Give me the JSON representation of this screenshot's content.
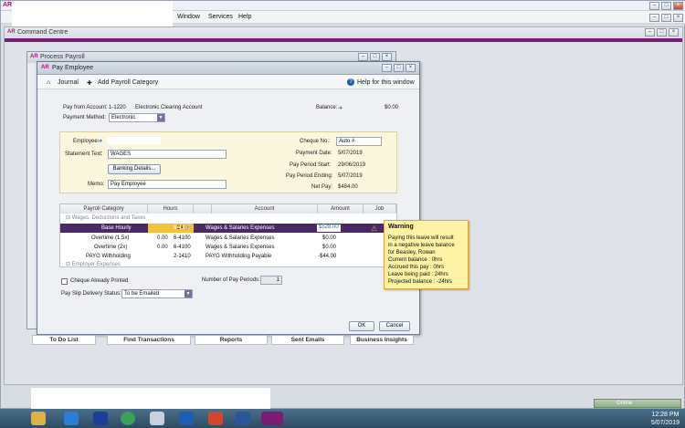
{
  "app": {
    "logo": "AR",
    "menu": [
      "Window",
      "Services",
      "Help"
    ],
    "command_centre_title": "Command Centre",
    "process_payroll_title": "Process Payroll"
  },
  "pay_employee": {
    "title": "Pay Employee",
    "toolbar": {
      "journal": "Journal",
      "add_payroll_category": "Add Payroll Category",
      "help": "Help for this window"
    },
    "pay_from_account_label": "Pay from Account:",
    "pay_from_account_code": "1-1220",
    "pay_from_account_name": "Electronic Clearing Account",
    "balance_label": "Balance:",
    "balance_value": "$0.00",
    "payment_method_label": "Payment Method:",
    "payment_method_value": "Electronic",
    "employee_label": "Employee:",
    "cheque_no_label": "Cheque No.:",
    "cheque_no_value": "Auto #",
    "statement_text_label": "Statement Text:",
    "statement_text_value": "WAGES",
    "payment_date_label": "Payment Date:",
    "payment_date_value": "5/07/2019",
    "banking_details_button": "Banking Details...",
    "pay_period_start_label": "Pay Period Start:",
    "pay_period_start_value": "29/06/2019",
    "pay_period_ending_label": "Pay Period Ending:",
    "pay_period_ending_value": "5/07/2019",
    "memo_label": "Memo:",
    "memo_value": "Pay Employee",
    "net_pay_label": "Net Pay:",
    "net_pay_value": "$484.00",
    "columns": [
      "Payroll Category",
      "Hours",
      "Account",
      "Amount",
      "Job"
    ],
    "group_1": "Wages, Deductions and Taxes",
    "rows": [
      {
        "category": "Base Hourly",
        "hours": "24.00",
        "account_code": "6-4100",
        "account_name": "Wages & Salaries Expenses",
        "amount": "$528.00"
      },
      {
        "category": "Overtime (1.5x)",
        "hours": "0.00",
        "account_code": "6-4100",
        "account_name": "Wages & Salaries Expenses",
        "amount": "$0.00"
      },
      {
        "category": "Overtime (2x)",
        "hours": "0.00",
        "account_code": "6-4100",
        "account_name": "Wages & Salaries Expenses",
        "amount": "$0.00"
      },
      {
        "category": "PAYG Withholding",
        "hours": "",
        "account_code": "2-1410",
        "account_name": "PAYG Withholding Payable",
        "amount": "-$44.00"
      }
    ],
    "group_2": "Employer Expenses",
    "cheque_printed_label": "Cheque Already Printed",
    "number_pay_periods_label": "Number of Pay Periods:",
    "number_pay_periods_value": "1",
    "pay_slip_label": "Pay Slip Delivery Status:",
    "pay_slip_value": "To be Emailed",
    "ok_button": "OK",
    "cancel_button": "Cancel"
  },
  "warning": {
    "title": "Warning",
    "body": "Paying this leave will result\nin a negative leave balance\nfor Beasley, Rowan\nCurrent balance : 0hrs\nAccrued this pay : 0hrs\nLeave being paid : 24hrs\nProjected balance : -24hrs"
  },
  "bottom_nav": [
    "To Do List",
    "Find Transactions",
    "Reports",
    "Sent Emails",
    "Business Insights"
  ],
  "taskbar": {
    "time": "12:28 PM",
    "date": "5/07/2019",
    "online": "Online"
  }
}
